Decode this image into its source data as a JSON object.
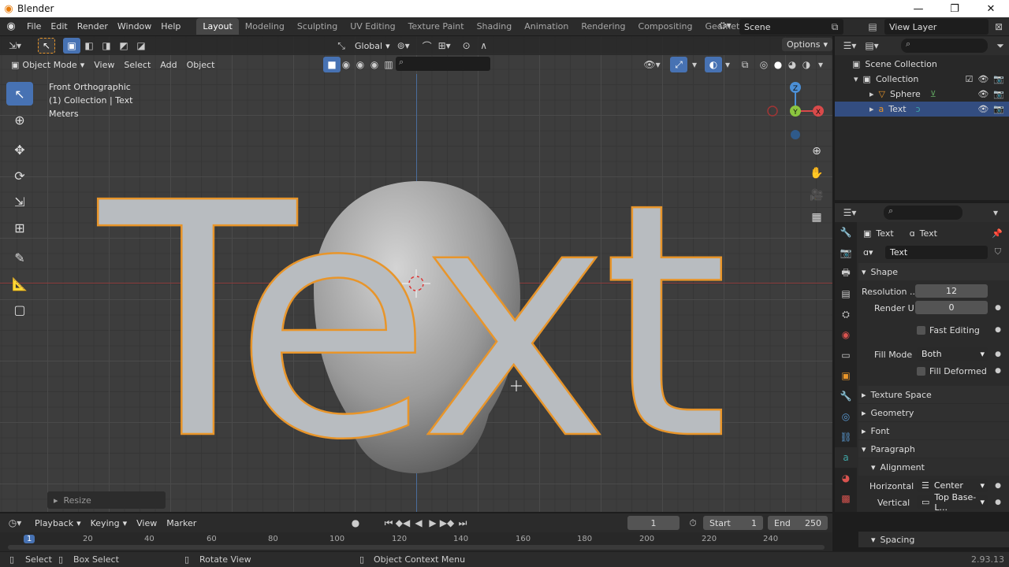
{
  "window": {
    "title": "Blender",
    "controls": [
      "—",
      "❐",
      "✕"
    ]
  },
  "menubar": {
    "items": [
      "File",
      "Edit",
      "Render",
      "Window",
      "Help"
    ],
    "tabs": [
      "Layout",
      "Modeling",
      "Sculpting",
      "UV Editing",
      "Texture Paint",
      "Shading",
      "Animation",
      "Rendering",
      "Compositing",
      "Geometry Nod"
    ],
    "active_tab": "Layout",
    "scene": "Scene",
    "view_layer": "View Layer"
  },
  "viewport": {
    "orientation": "Global",
    "options_label": "Options",
    "mode": "Object Mode",
    "menus": [
      "View",
      "Select",
      "Add",
      "Object"
    ],
    "info_lines": [
      "Front Orthographic",
      "(1) Collection | Text",
      "Meters"
    ],
    "text_object": "Text",
    "last_op": "Resize",
    "gizmo": {
      "x": "X",
      "y": "Y",
      "z": "Z"
    }
  },
  "outliner": {
    "rows": [
      {
        "label": "Scene Collection"
      },
      {
        "label": "Collection"
      },
      {
        "label": "Sphere"
      },
      {
        "label": "Text"
      }
    ]
  },
  "properties": {
    "context_obj": "Text",
    "context_data": "Text",
    "data_name": "Text",
    "shape_label": "Shape",
    "resolution_label": "Resolution ...",
    "resolution_value": "12",
    "render_u_label": "Render U",
    "render_u_value": "0",
    "fast_editing": "Fast Editing",
    "fill_mode_label": "Fill Mode",
    "fill_mode_value": "Both",
    "fill_deformed": "Fill Deformed",
    "sections": [
      "Texture Space",
      "Geometry",
      "Font",
      "Paragraph"
    ],
    "alignment_label": "Alignment",
    "horizontal_label": "Horizontal",
    "horizontal_value": "Center",
    "vertical_label": "Vertical",
    "vertical_value": "Top Base-L...",
    "spacing_label": "Spacing"
  },
  "timeline": {
    "menus": [
      "Playback",
      "Keying",
      "View",
      "Marker"
    ],
    "current_frame": "1",
    "start_label": "Start",
    "start_value": "1",
    "end_label": "End",
    "end_value": "250",
    "ruler": [
      "1",
      "20",
      "40",
      "60",
      "80",
      "100",
      "120",
      "140",
      "160",
      "180",
      "200",
      "220",
      "240"
    ]
  },
  "statusbar": {
    "select": "Select",
    "box_select": "Box Select",
    "rotate_view": "Rotate View",
    "context_menu": "Object Context Menu",
    "version": "2.93.13"
  }
}
